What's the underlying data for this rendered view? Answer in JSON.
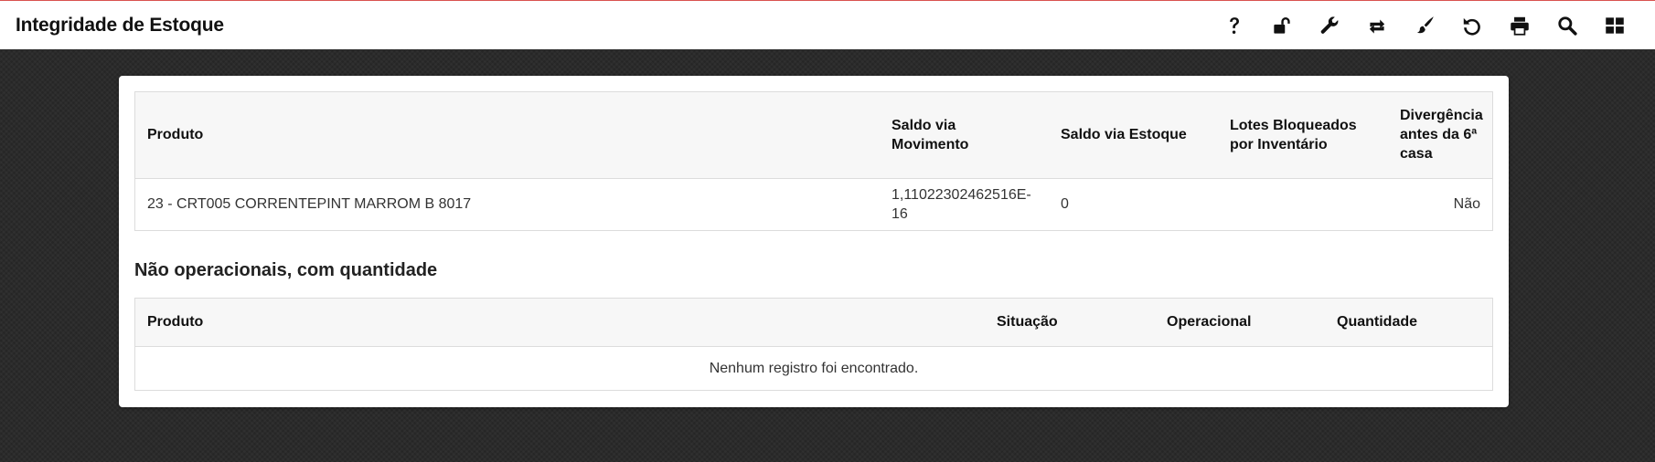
{
  "header": {
    "title": "Integridade de Estoque",
    "tools": [
      {
        "icon": "help-icon"
      },
      {
        "icon": "unlock-icon"
      },
      {
        "icon": "wrench-icon"
      },
      {
        "icon": "repeat-icon"
      },
      {
        "icon": "brush-icon"
      },
      {
        "icon": "undo-icon"
      },
      {
        "icon": "print-icon"
      },
      {
        "icon": "search-icon"
      },
      {
        "icon": "layout-icon"
      }
    ]
  },
  "integrity_table": {
    "columns": [
      "Produto",
      "Saldo via Movimento",
      "Saldo via Estoque",
      "Lotes Bloqueados por Inventário",
      "Divergência antes da 6ª casa"
    ],
    "rows": [
      {
        "produto": "23 - CRT005 CORRENTEPINT MARROM B 8017",
        "saldo_movimento": "1,11022302462516E-16",
        "saldo_estoque": "0",
        "lotes_bloqueados": "",
        "divergencia": "Não"
      }
    ]
  },
  "non_operational": {
    "title": "Não operacionais, com quantidade",
    "columns": [
      "Produto",
      "Situação",
      "Operacional",
      "Quantidade"
    ],
    "empty_message": "Nenhum registro foi encontrado."
  }
}
